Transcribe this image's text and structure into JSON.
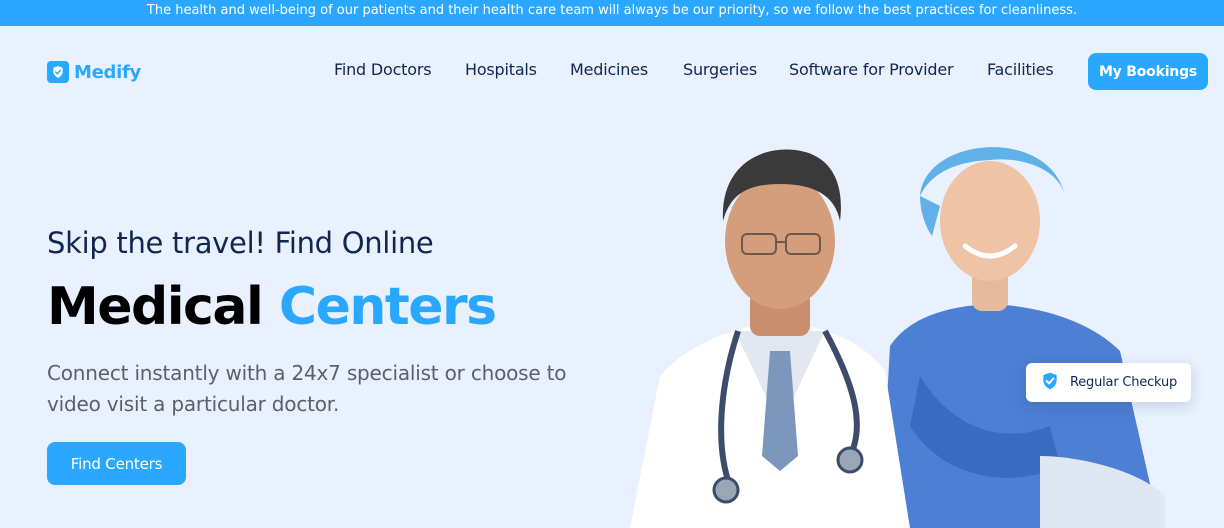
{
  "announcement": "The health and well-being of our patients and their health care team will always be our priority, so we follow the best practices for cleanliness.",
  "brand": {
    "name": "Medify",
    "icon": "shield-check-icon",
    "color": "#2AA7FF"
  },
  "nav": {
    "links": [
      "Find Doctors",
      "Hospitals",
      "Medicines",
      "Surgeries",
      "Software for Provider",
      "Facilities"
    ],
    "cta_label": "My Bookings"
  },
  "hero": {
    "subtitle": "Skip the travel! Find Online",
    "title_dark": "Medical",
    "title_accent": "Centers",
    "description": "Connect instantly with a 24x7 specialist or choose to video visit a particular doctor.",
    "cta_label": "Find Centers"
  },
  "badge": {
    "label": "Regular Checkup",
    "icon": "shield-check-icon"
  },
  "colors": {
    "accent": "#2AA7FF",
    "heading": "#102851",
    "background": "#E8F1FD"
  }
}
